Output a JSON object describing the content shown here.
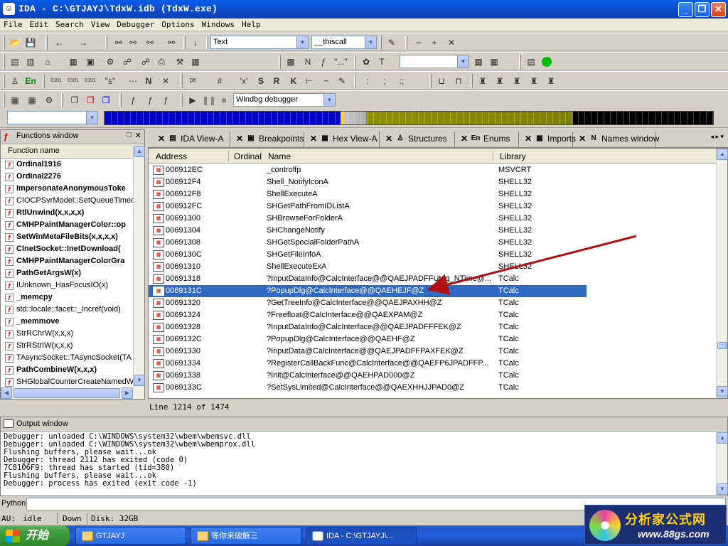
{
  "window": {
    "title": "IDA - C:\\GTJAYJ\\TdxW.idb (TdxW.exe)",
    "icon_letter": "☺"
  },
  "window_buttons": {
    "minimize": "_",
    "maximize": "❐",
    "close": "✕"
  },
  "menu": [
    "File",
    "Edit",
    "Search",
    "View",
    "Debugger",
    "Options",
    "Windows",
    "Help"
  ],
  "toolbar": {
    "text_combo": "Text",
    "callconv_combo": "__thiscall",
    "debugger_combo": "Windbg debugger",
    "empty_combo": ""
  },
  "functions_window": {
    "title": "Functions window",
    "column": "Function name",
    "items": [
      {
        "name": "Ordinal1916",
        "bold": true
      },
      {
        "name": "Ordinal2276",
        "bold": true
      },
      {
        "name": "ImpersonateAnonymousToke",
        "bold": true
      },
      {
        "name": "CIOCPSvrModel::SetQueueTimeo",
        "bold": false
      },
      {
        "name": "RtlUnwind(x,x,x,x)",
        "bold": true
      },
      {
        "name": "CMHPPaintManagerColor::op",
        "bold": true
      },
      {
        "name": "SetWinMetaFileBits(x,x,x,x)",
        "bold": true
      },
      {
        "name": "CInetSocket::InetDownload(",
        "bold": true
      },
      {
        "name": "CMHPPaintManagerColorGra",
        "bold": true
      },
      {
        "name": "PathGetArgsW(x)",
        "bold": true
      },
      {
        "name": "IUnknown_HasFocusIO(x)",
        "bold": false
      },
      {
        "name": "_memcpy",
        "bold": true
      },
      {
        "name": "std::locale::facet::_Incref(void)",
        "bold": false
      },
      {
        "name": "_memmove",
        "bold": true
      },
      {
        "name": "StrRChrW(x,x,x)",
        "bold": false
      },
      {
        "name": "StrRStrIW(x,x,x)",
        "bold": false
      },
      {
        "name": "TAsyncSocket::TAsyncSocket(TA",
        "bold": false
      },
      {
        "name": "PathCombineW(x,x,x)",
        "bold": true
      },
      {
        "name": "SHGlobalCounterCreateNamedW(",
        "bold": false
      }
    ]
  },
  "tabs": [
    {
      "label": "IDA View-A",
      "icon": "▤"
    },
    {
      "label": "Breakpoints",
      "icon": "▣"
    },
    {
      "label": "Hex View-A",
      "icon": "▦"
    },
    {
      "label": "Structures",
      "icon": "♙"
    },
    {
      "label": "Enums",
      "icon": "En"
    },
    {
      "label": "Imports",
      "icon": "▩"
    },
    {
      "label": "Names window",
      "icon": "N"
    }
  ],
  "imports": {
    "columns": [
      "Address",
      "Ordinal",
      "Name",
      "Library"
    ],
    "rows": [
      {
        "address": "006912EC",
        "ordinal": "",
        "name": "_controlfp",
        "library": "MSVCRT"
      },
      {
        "address": "006912F4",
        "ordinal": "",
        "name": "Shell_NotifyIconA",
        "library": "SHELL32"
      },
      {
        "address": "006912F8",
        "ordinal": "",
        "name": "ShellExecuteA",
        "library": "SHELL32"
      },
      {
        "address": "006912FC",
        "ordinal": "",
        "name": "SHGetPathFromIDListA",
        "library": "SHELL32"
      },
      {
        "address": "00691300",
        "ordinal": "",
        "name": "SHBrowseForFolderA",
        "library": "SHELL32"
      },
      {
        "address": "00691304",
        "ordinal": "",
        "name": "SHChangeNotify",
        "library": "SHELL32"
      },
      {
        "address": "00691308",
        "ordinal": "",
        "name": "SHGetSpecialFolderPathA",
        "library": "SHELL32"
      },
      {
        "address": "0069130C",
        "ordinal": "",
        "name": "SHGetFileInfoA",
        "library": "SHELL32"
      },
      {
        "address": "00691310",
        "ordinal": "",
        "name": "ShellExecuteExA",
        "library": "SHELL32"
      },
      {
        "address": "00691318",
        "ordinal": "",
        "name": "?InputDataInfo@CalcInterface@@QAEJPADFFUtag_NTime@...",
        "library": "TCalc"
      },
      {
        "address": "0069131C",
        "ordinal": "",
        "name": "?PopupDlg@CalcInterface@@QAEHEJF@Z",
        "library": "TCalc",
        "selected": true
      },
      {
        "address": "00691320",
        "ordinal": "",
        "name": "?GetTreeInfo@CalcInterface@@QAEJPAXHH@Z",
        "library": "TCalc"
      },
      {
        "address": "00691324",
        "ordinal": "",
        "name": "?Freefloat@CalcInterface@@QAEXPAM@Z",
        "library": "TCalc"
      },
      {
        "address": "00691328",
        "ordinal": "",
        "name": "?InputDataInfo@CalcInterface@@QAEJPADFFFEK@Z",
        "library": "TCalc"
      },
      {
        "address": "0069132C",
        "ordinal": "",
        "name": "?PopupDlg@CalcInterface@@QAEHF@Z",
        "library": "TCalc"
      },
      {
        "address": "00691330",
        "ordinal": "",
        "name": "?InputData@CalcInterface@@QAEJPADFFPAXFEK@Z",
        "library": "TCalc"
      },
      {
        "address": "00691334",
        "ordinal": "",
        "name": "?RegisterCallBackFunc@CalcInterface@@QAEFP6JPADFFP...",
        "library": "TCalc"
      },
      {
        "address": "00691338",
        "ordinal": "",
        "name": "?Init@CalcInterface@@QAEHPAD000@Z",
        "library": "TCalc"
      },
      {
        "address": "0069133C",
        "ordinal": "",
        "name": "?SetSysLimited@CalcInterface@@QAEXHHJJPAD0@Z",
        "library": "TCalc"
      }
    ]
  },
  "status_line": "Line 1214 of 1474",
  "output_window": {
    "title": "Output window",
    "lines": [
      "Debugger: unloaded C:\\WINDOWS\\system32\\wbem\\wbemsvc.dll",
      "Debugger: unloaded C:\\WINDOWS\\system32\\wbem\\wbemprox.dll",
      "Flushing buffers, please wait...ok",
      "Debugger: thread 2112 has exited (code 0)",
      "7C8106F9: thread has started (tid=380)",
      "Flushing buffers, please wait...ok",
      "Debugger: process has exited (exit code -1)"
    ]
  },
  "python_label": "Python",
  "ida_status": {
    "au": "AU:",
    "state": "idle",
    "direction": "Down",
    "disk": "Disk: 32GB"
  },
  "taskbar": {
    "start": "开始",
    "tasks": [
      "GTJAYJ",
      "等你来破解三",
      "IDA - C:\\GTJAYJ\\..."
    ]
  },
  "watermark": {
    "name": "分析家公式网",
    "url": "www.88gs.com"
  },
  "colors": {
    "selection": "#316ac5",
    "arrow": "#b01010"
  }
}
